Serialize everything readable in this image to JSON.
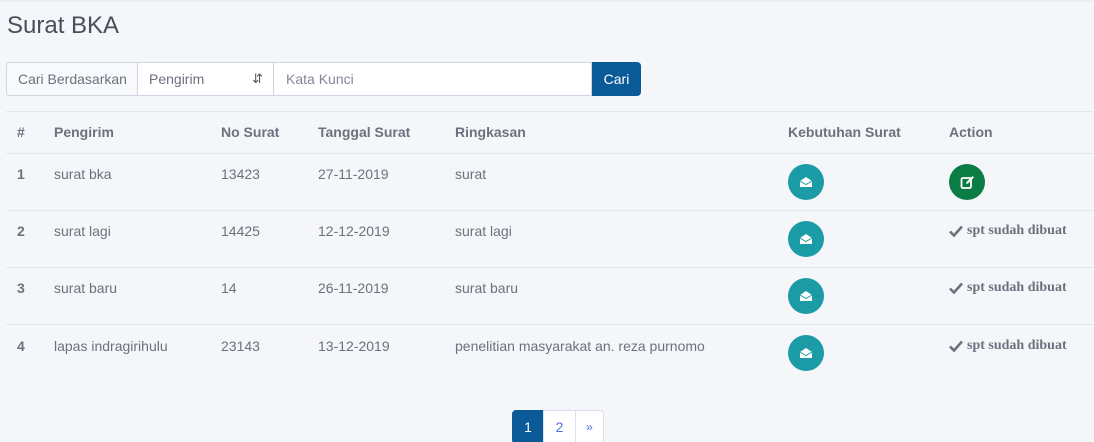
{
  "page": {
    "title": "Surat BKA"
  },
  "search": {
    "label": "Cari Berdasarkan",
    "select_value": "Pengirim",
    "placeholder": "Kata Kunci",
    "button_label": "Cari"
  },
  "table": {
    "headers": [
      "#",
      "Pengirim",
      "No Surat",
      "Tanggal Surat",
      "Ringkasan",
      "Kebutuhan Surat",
      "Action"
    ],
    "rows": [
      {
        "no": "1",
        "pengirim": "surat bka",
        "no_surat": "13423",
        "tanggal": "27-11-2019",
        "ringkasan": "surat",
        "action": "edit"
      },
      {
        "no": "2",
        "pengirim": "surat lagi",
        "no_surat": "14425",
        "tanggal": "12-12-2019",
        "ringkasan": "surat lagi",
        "action_text": "spt sudah dibuat"
      },
      {
        "no": "3",
        "pengirim": "surat baru",
        "no_surat": "14",
        "tanggal": "26-11-2019",
        "ringkasan": "surat baru",
        "action_text": "spt sudah dibuat"
      },
      {
        "no": "4",
        "pengirim": "lapas indragirihulu",
        "no_surat": "23143",
        "tanggal": "13-12-2019",
        "ringkasan": "penelitian masyarakat an. reza purnomo",
        "action_text": "spt sudah dibuat"
      }
    ]
  },
  "icons": {
    "kebutuhan": "envelope-open-icon",
    "edit": "edit-icon",
    "done": "check-icon"
  },
  "colors": {
    "primary": "#0b5a98",
    "teal": "#1a9ba5",
    "green": "#0c7c45"
  },
  "pagination": {
    "pages": [
      "1",
      "2"
    ],
    "next": "»",
    "active": "1"
  }
}
